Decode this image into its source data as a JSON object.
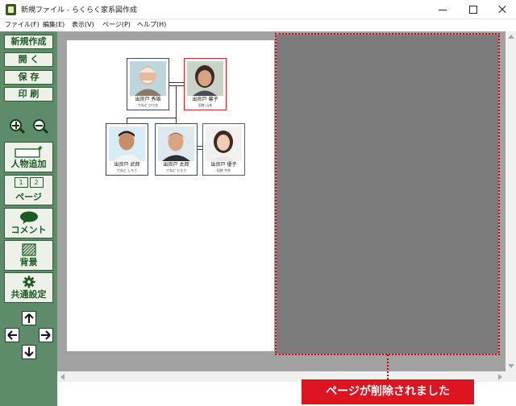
{
  "window": {
    "title": "新規ファイル - らくらく家系図作成"
  },
  "menu": [
    "ファイル(F)",
    "編集(E)",
    "表示(V)",
    "ページ(P)",
    "ヘルプ(H)"
  ],
  "toolbar": {
    "new": "新規作成",
    "open": "開 く",
    "save": "保 存",
    "print": "印 刷",
    "add_person": "人物追加",
    "page": "ページ",
    "page_icon_numbers": [
      "1",
      "2"
    ],
    "comment": "コメント",
    "background": "背景",
    "settings": "共通設定"
  },
  "people": [
    {
      "name": "出良戸 秀雄",
      "reading": "でねど ひでお",
      "gender": "male"
    },
    {
      "name": "出良戸 馨子",
      "reading": "旧姓 山本",
      "gender": "female"
    },
    {
      "name": "出良戸 武郎",
      "reading": "でねど しろう",
      "gender": "male"
    },
    {
      "name": "出良戸 太郎",
      "reading": "でねど たろう",
      "gender": "male"
    },
    {
      "name": "出良戸 優子",
      "reading": "旧姓 今井",
      "gender": "female"
    }
  ],
  "notification": "ページが削除されました",
  "colors": {
    "toolbar_bg": "#5e8b69",
    "button_text": "#1c5a22",
    "male_border": "#2f4a6a",
    "female_border": "#e0252b",
    "deleted_page": "#7b7b7b",
    "alert": "#dd1520"
  }
}
